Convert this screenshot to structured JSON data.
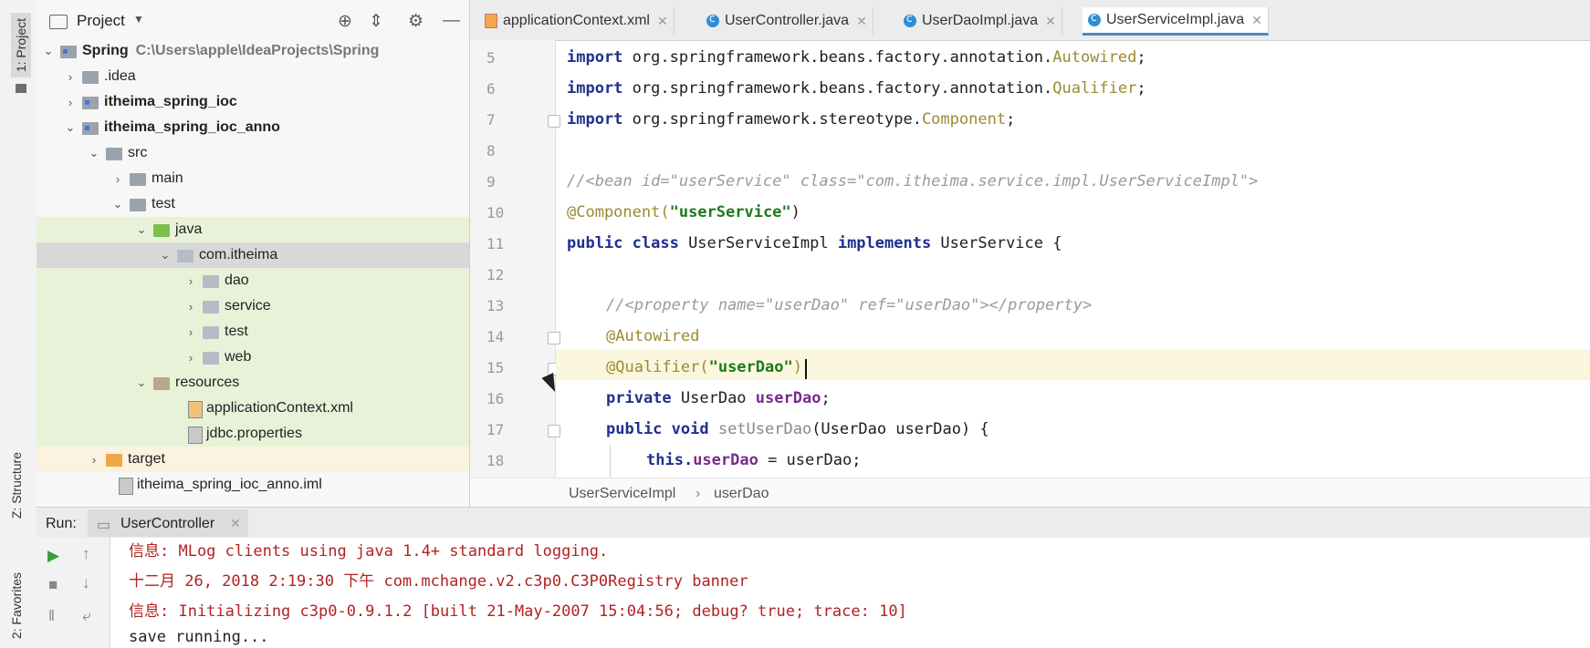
{
  "sidebar": {
    "project_tab": "1: Project",
    "structure_tab": "Z: Structure",
    "favorites_tab": "2: Favorites"
  },
  "project_panel": {
    "title": "Project",
    "tree": [
      {
        "label": "Spring",
        "extra": "C:\\Users\\apple\\IdeaProjects\\Spring"
      },
      {
        "label": ".idea"
      },
      {
        "label": "itheima_spring_ioc"
      },
      {
        "label": "itheima_spring_ioc_anno"
      },
      {
        "label": "src"
      },
      {
        "label": "main"
      },
      {
        "label": "test"
      },
      {
        "label": "java"
      },
      {
        "label": "com.itheima"
      },
      {
        "label": "dao"
      },
      {
        "label": "service"
      },
      {
        "label": "test"
      },
      {
        "label": "web"
      },
      {
        "label": "resources"
      },
      {
        "label": "applicationContext.xml"
      },
      {
        "label": "jdbc.properties"
      },
      {
        "label": "target"
      },
      {
        "label": "itheima_spring_ioc_anno.iml"
      }
    ]
  },
  "editor": {
    "tabs": [
      {
        "label": "applicationContext.xml"
      },
      {
        "label": "UserController.java"
      },
      {
        "label": "UserDaoImpl.java"
      },
      {
        "label": "UserServiceImpl.java"
      }
    ],
    "active_tab": "UserServiceImpl.java",
    "line_numbers": [
      "5",
      "6",
      "7",
      "8",
      "9",
      "10",
      "11",
      "12",
      "13",
      "14",
      "15",
      "16",
      "17",
      "18"
    ],
    "lines": {
      "l5_kw": "import",
      "l5_rest": " org.springframework.beans.factory.annotation.",
      "l5_cls": "Autowired",
      "l5_end": ";",
      "l6_kw": "import",
      "l6_rest": " org.springframework.beans.factory.annotation.",
      "l6_cls": "Qualifier",
      "l6_end": ";",
      "l7_kw": "import",
      "l7_rest": " org.springframework.stereotype.",
      "l7_cls": "Component",
      "l7_end": ";",
      "l9_comment": "//<bean id=\"userService\" class=\"com.itheima.service.impl.UserServiceImpl\">",
      "l10_ann": "@Component(",
      "l10_str": "\"userService\"",
      "l10_end": ")",
      "l11_kw1": "public class",
      "l11_name": " UserServiceImpl ",
      "l11_kw2": "implements",
      "l11_rest": " UserService {",
      "l13_comment": "//<property name=\"userDao\" ref=\"userDao\"></property>",
      "l14_ann": "@Autowired",
      "l15_ann": "@Qualifier(",
      "l15_str": "\"userDao\"",
      "l15_end": ")",
      "l16_kw": "private",
      "l16_type": " UserDao ",
      "l16_fld": "userDao",
      "l16_end": ";",
      "l17_kw": "public void",
      "l17_mth": " setUserDao",
      "l17_rest": "(UserDao userDao) {",
      "l18_kw": "this.",
      "l18_fld": "userDao",
      "l18_rest": " = userDao;"
    },
    "breadcrumb": [
      "UserServiceImpl",
      "userDao"
    ]
  },
  "run": {
    "label": "Run:",
    "tab": "UserController",
    "console": [
      "信息: MLog clients using java 1.4+ standard logging.",
      "十二月 26, 2018 2:19:30 下午 com.mchange.v2.c3p0.C3P0Registry banner",
      "信息: Initializing c3p0-0.9.1.2 [built 21-May-2007 15:04:56; debug? true; trace: 10]",
      "save running..."
    ]
  }
}
